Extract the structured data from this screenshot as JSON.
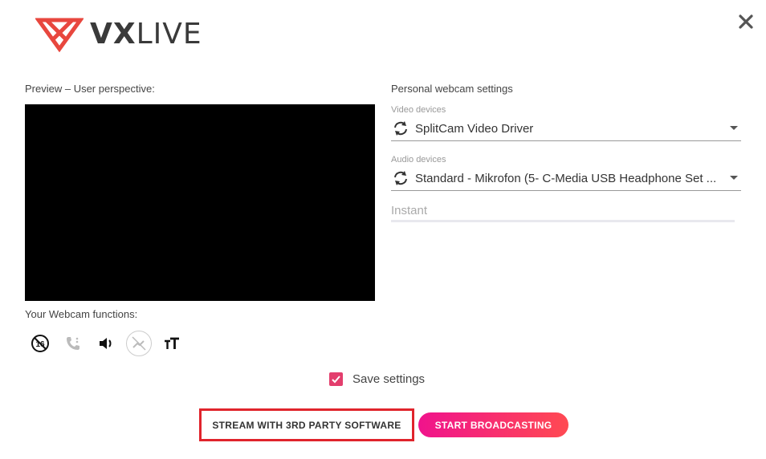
{
  "header": {
    "logo_bold": "VX",
    "logo_light": "LIVE"
  },
  "preview": {
    "label": "Preview – User perspective:"
  },
  "webcam_functions": {
    "label": "Your Webcam functions:",
    "icons": [
      "age-16-icon",
      "phone-muted-icon",
      "volume-icon",
      "no-tip-icon",
      "text-size-icon"
    ]
  },
  "settings": {
    "title": "Personal webcam settings",
    "video_caption": "Video devices",
    "video_value": "SplitCam Video Driver",
    "audio_caption": "Audio devices",
    "audio_value": "Standard - Mikrofon (5- C-Media USB Headphone Set ...",
    "instant_placeholder": "Instant"
  },
  "save": {
    "label": "Save settings",
    "checked": true
  },
  "buttons": {
    "third_party": "STREAM WITH 3RD PARTY SOFTWARE",
    "start": "START BROADCASTING"
  },
  "colors": {
    "accent": "#e33e6d",
    "highlight_border": "#e0242c",
    "gradient_start": "#f0138c",
    "gradient_end": "#ff4a52"
  }
}
